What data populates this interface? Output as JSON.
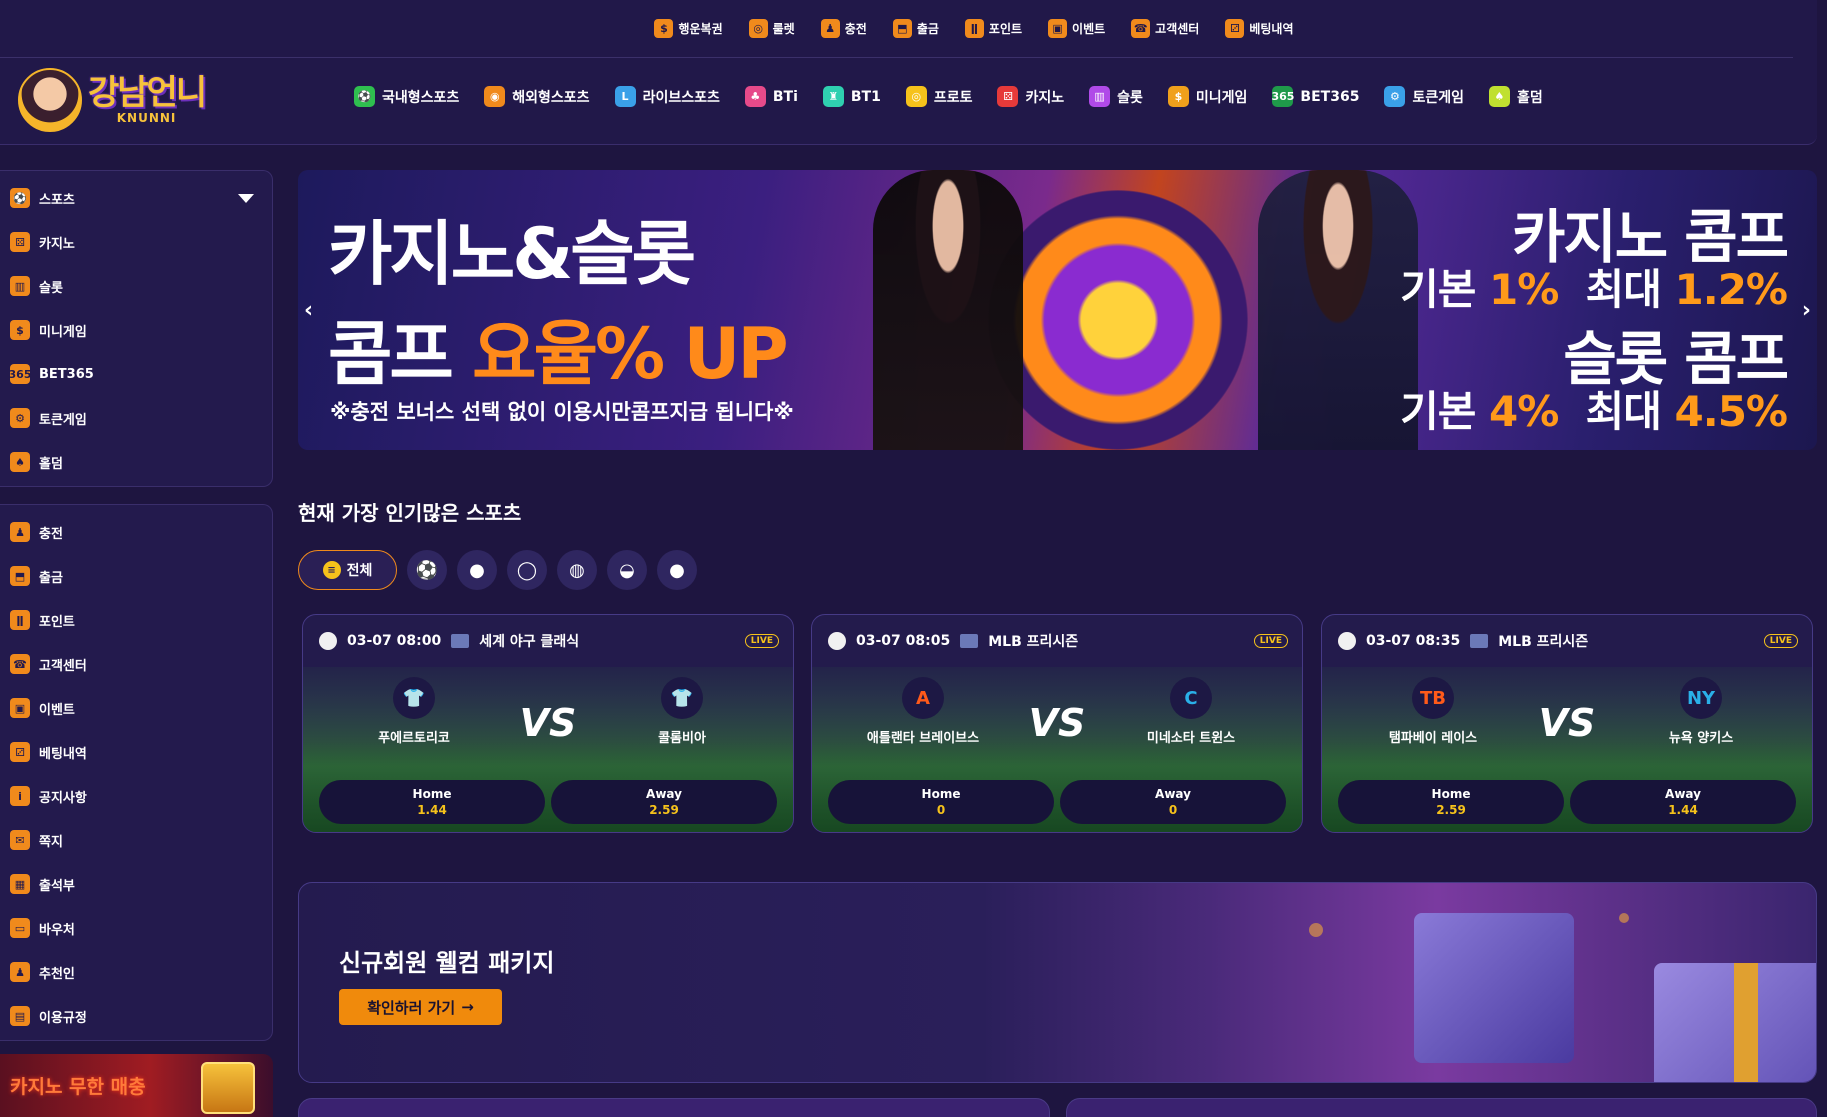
{
  "top_nav": [
    {
      "label": "행운복권",
      "icon": "$"
    },
    {
      "label": "룰렛",
      "icon": "◎"
    },
    {
      "label": "충전",
      "icon": "♟"
    },
    {
      "label": "출금",
      "icon": "⬒"
    },
    {
      "label": "포인트",
      "icon": "ǁ"
    },
    {
      "label": "이벤트",
      "icon": "▣"
    },
    {
      "label": "고객센터",
      "icon": "☎"
    },
    {
      "label": "베팅내역",
      "icon": "⚂"
    }
  ],
  "logo": {
    "title": "강남언니",
    "subtitle": "KNUNNI"
  },
  "main_nav": [
    {
      "label": "국내형스포츠",
      "icon": "⚽",
      "color": "#2fbf4f"
    },
    {
      "label": "해외형스포츠",
      "icon": "◉",
      "color": "#f08a1c"
    },
    {
      "label": "라이브스포츠",
      "icon": "L",
      "color": "#3aa0e8"
    },
    {
      "label": "BTi",
      "icon": "♣",
      "color": "#e64a8a"
    },
    {
      "label": "BT1",
      "icon": "♜",
      "color": "#2fd0b0"
    },
    {
      "label": "프로토",
      "icon": "◎",
      "color": "#f6c21b"
    },
    {
      "label": "카지노",
      "icon": "⚄",
      "color": "#e63a3a"
    },
    {
      "label": "슬롯",
      "icon": "▥",
      "color": "#b04ae8"
    },
    {
      "label": "미니게임",
      "icon": "$",
      "color": "#f0a01c"
    },
    {
      "label": "BET365",
      "icon": "365",
      "color": "#1f9a4a"
    },
    {
      "label": "토큰게임",
      "icon": "⚙",
      "color": "#3aa0e8"
    },
    {
      "label": "홀덤",
      "icon": "♠",
      "color": "#c0e030"
    }
  ],
  "sidebar_top": [
    {
      "label": "스포츠",
      "icon": "⚽"
    },
    {
      "label": "카지노",
      "icon": "⚄"
    },
    {
      "label": "슬롯",
      "icon": "▥"
    },
    {
      "label": "미니게임",
      "icon": "$"
    },
    {
      "label": "BET365",
      "icon": "365"
    },
    {
      "label": "토큰게임",
      "icon": "⚙"
    },
    {
      "label": "홀덤",
      "icon": "♠"
    }
  ],
  "sidebar_bottom": [
    {
      "label": "충전",
      "icon": "♟"
    },
    {
      "label": "출금",
      "icon": "⬒"
    },
    {
      "label": "포인트",
      "icon": "ǁ"
    },
    {
      "label": "고객센터",
      "icon": "☎"
    },
    {
      "label": "이벤트",
      "icon": "▣"
    },
    {
      "label": "베팅내역",
      "icon": "⚂"
    },
    {
      "label": "공지사항",
      "icon": "i"
    },
    {
      "label": "쪽지",
      "icon": "✉"
    },
    {
      "label": "출석부",
      "icon": "▦"
    },
    {
      "label": "바우처",
      "icon": "▭"
    },
    {
      "label": "추천인",
      "icon": "♟"
    },
    {
      "label": "이용규정",
      "icon": "▤"
    }
  ],
  "side_promo": "카지노 무한 매충",
  "banner": {
    "left_line1": "카지노&슬롯",
    "left_line2a": "콤프 ",
    "left_line2b": "요율% UP",
    "left_line3": "※충전 보너스 선택 없이 이용시만콤프지급 됩니다※",
    "right_line1": "카지노 콤프",
    "right_line2a": "기본 ",
    "right_line2b": "1%",
    "right_line2c": "  최대 ",
    "right_line2d": "1.2%",
    "right_line3": "슬롯 콤프",
    "right_line4a": "기본 ",
    "right_line4b": "4%",
    "right_line4c": "  최대 ",
    "right_line4d": "4.5%"
  },
  "popular": {
    "title": "현재 가장 인기많은 스포츠",
    "all_label": "전체",
    "filters": [
      "⚽",
      "●",
      "◯",
      "◍",
      "◒",
      "●"
    ]
  },
  "matches": [
    {
      "time": "03-07 08:00",
      "league": "세계 야구 클래식",
      "live": "LIVE",
      "home": "푸에르토리코",
      "away": "콜롬비아",
      "home_logo": "👕",
      "away_logo": "👕",
      "home_label": "Home",
      "away_label": "Away",
      "home_odds": "1.44",
      "away_odds": "2.59",
      "vs": "VS"
    },
    {
      "time": "03-07 08:05",
      "league": "MLB 프리시즌",
      "live": "LIVE",
      "home": "애틀랜타 브레이브스",
      "away": "미네소타 트윈스",
      "home_logo": "A",
      "away_logo": "C",
      "home_label": "Home",
      "away_label": "Away",
      "home_odds": "0",
      "away_odds": "0",
      "vs": "VS"
    },
    {
      "time": "03-07 08:35",
      "league": "MLB 프리시즌",
      "live": "LIVE",
      "home": "탬파베이 레이스",
      "away": "뉴욕 양키스",
      "home_logo": "TB",
      "away_logo": "NY",
      "home_label": "Home",
      "away_label": "Away",
      "home_odds": "2.59",
      "away_odds": "1.44",
      "vs": "VS"
    }
  ],
  "welcome": {
    "title": "신규회원 웰컴 패키지",
    "button": "확인하러 가기",
    "arrow": "→"
  },
  "arrows": {
    "left": "‹",
    "right": "›"
  }
}
